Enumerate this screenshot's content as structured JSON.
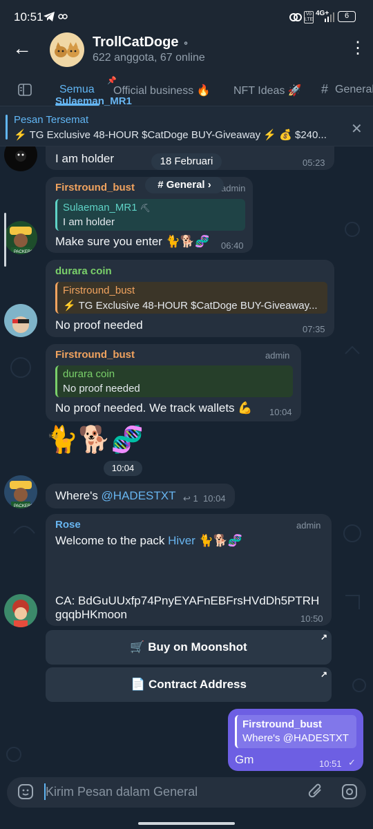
{
  "status_bar": {
    "time": "10:51",
    "network": "4G+",
    "battery": "6",
    "icons": [
      "telegram-icon",
      "link-icon",
      "vowifi-icon",
      "volte-icon",
      "signal-icon",
      "battery-icon"
    ]
  },
  "header": {
    "title": "TrollCatDoge",
    "subtitle": "622 anggota, 67 online",
    "muted_icon": "mute-icon"
  },
  "tabs": [
    {
      "label": "Semua",
      "active": true
    },
    {
      "label": "Official business 🔥",
      "active": false
    },
    {
      "label": "NFT Ideas 🚀",
      "active": false
    },
    {
      "label": "General",
      "active": false
    }
  ],
  "pinned": {
    "title": "Pesan Tersemat",
    "text": "⚡ TG Exclusive 48-HOUR $CatDoge BUY-Giveaway ⚡ 💰 $240..."
  },
  "date_chip": "18 Februari",
  "topic_chip": "General",
  "messages": [
    {
      "sender": "Sulaeman_MR1",
      "text": "I am holder",
      "time": "05:23"
    },
    {
      "sender": "Firstround_bust",
      "badge": "admin",
      "quote_name": "Sulaeman_MR1",
      "quote_text": "I am holder",
      "text": "Make sure you enter 🐈🐕🧬",
      "time": "06:40"
    },
    {
      "sender": "durara coin",
      "quote_name": "Firstround_bust",
      "quote_text": "⚡ TG Exclusive 48-HOUR $CatDoge BUY-Giveaway...",
      "text": "No proof needed",
      "time": "07:35"
    },
    {
      "sender": "Firstround_bust",
      "badge": "admin",
      "quote_name": "durara coin",
      "quote_text": "No proof needed",
      "text": "No proof needed. We track wallets 💪",
      "time": "10:04"
    },
    {
      "emoji": "🐈🐕🧬",
      "time": "10:04"
    },
    {
      "text_prefix": "Where's ",
      "mention": "@HADESTXT",
      "reply_count": "1",
      "time": "10:04"
    },
    {
      "sender": "Rose",
      "badge": "admin",
      "text_prefix": "Welcome to the pack ",
      "mention": "Hiver",
      "emoji": "🐈🐕🧬",
      "ca_line1": "CA: BdGuUUxfp74PnyEYAFnEBFrsHVdDh5PTRH",
      "ca_line2": "gqqbHKmoon",
      "time": "10:50"
    }
  ],
  "buttons": [
    {
      "icon": "🛒",
      "label": "Buy on Moonshot"
    },
    {
      "icon": "📄",
      "label": "Contract Address"
    }
  ],
  "outgoing": {
    "quote_name": "Firstround_bust",
    "quote_text": "Where's @HADESTXT",
    "text": "Gm",
    "time": "10:51"
  },
  "input": {
    "placeholder": "Kirim Pesan dalam General"
  },
  "colors": {
    "accent": "#61b6f4",
    "header_bg": "#1d2733",
    "bubble_bg": "#25303e",
    "outgoing_bg": "#6d5fe3",
    "orange_name": "#f1a35f",
    "green_name": "#7ad06a",
    "teal_name": "#5fd3c6",
    "blue_name": "#68b5f0"
  }
}
